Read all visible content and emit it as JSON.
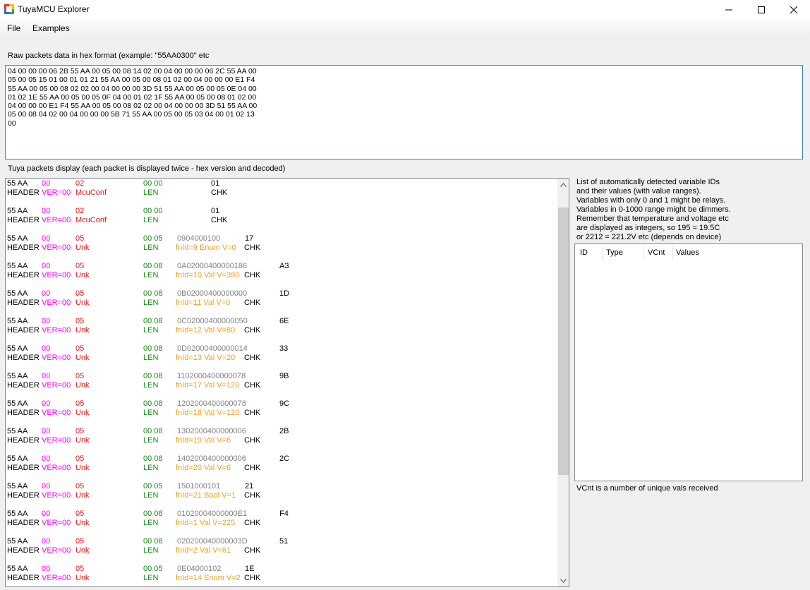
{
  "window": {
    "title": "TuyaMCU Explorer"
  },
  "menu": {
    "file": "File",
    "examples": "Examples"
  },
  "raw": {
    "label": "Raw packets data in hex format (example: \"55AA0300\" etc",
    "value": "04 00 00 00 06 2B 55 AA 00 05 00 08 14 02 00 04 00 00 00 06 2C 55 AA 00\n05 00 05 15 01 00 01 01 21 55 AA 00 05 00 08 01 02 00 04 00 00 00 E1 F4\n55 AA 00 05 00 08 02 02 00 04 00 00 00 3D 51 55 AA 00 05 00 05 0E 04 00\n01 02 1E 55 AA 00 05 00 05 0F 04 00 01 02 1F 55 AA 00 05 00 08 01 02 00\n04 00 00 00 E1 F4 55 AA 00 05 00 08 02 02 00 04 00 00 00 3D 51 55 AA 00\n05 00 08 04 02 00 04 00 00 00 5B 71 55 AA 00 05 00 05 03 04 00 01 02 13\n00\n"
  },
  "packets_label": "Tuya packets display (each packet is displayed twice - hex version and decoded)",
  "packets": [
    {
      "hdr": "55 AA",
      "ver": "00",
      "cmd": "02",
      "len": "00 00",
      "data": "",
      "chk": "01",
      "hdr2": "HEADER",
      "ver2": "VER=00",
      "cmd2": "McuConf",
      "len2": "LEN",
      "data2": "",
      "chk2": "CHK"
    },
    {
      "hdr": "55 AA",
      "ver": "00",
      "cmd": "02",
      "len": "00 00",
      "data": "",
      "chk": "01",
      "hdr2": "HEADER",
      "ver2": "VER=00",
      "cmd2": "McuConf",
      "len2": "LEN",
      "data2": "",
      "chk2": "CHK"
    },
    {
      "hdr": "55 AA",
      "ver": "00",
      "cmd": "05",
      "len": "00 05",
      "data": "0904000100",
      "chk": "17",
      "hdr2": "HEADER",
      "ver2": "VER=00",
      "cmd2": "Unk",
      "len2": "LEN",
      "data2": "fnId=9 Enum V=0",
      "chk2": "CHK"
    },
    {
      "hdr": "55 AA",
      "ver": "00",
      "cmd": "05",
      "len": "00 08",
      "data": "0A02000400000186",
      "chk": "A3",
      "hdr2": "HEADER",
      "ver2": "VER=00",
      "cmd2": "Unk",
      "len2": "LEN",
      "data2": "fnId=10 Val V=390",
      "chk2": "CHK"
    },
    {
      "hdr": "55 AA",
      "ver": "00",
      "cmd": "05",
      "len": "00 08",
      "data": "0B02000400000000",
      "chk": "1D",
      "hdr2": "HEADER",
      "ver2": "VER=00",
      "cmd2": "Unk",
      "len2": "LEN",
      "data2": "fnId=11 Val V=0",
      "chk2": "CHK"
    },
    {
      "hdr": "55 AA",
      "ver": "00",
      "cmd": "05",
      "len": "00 08",
      "data": "0C02000400000050",
      "chk": "6E",
      "hdr2": "HEADER",
      "ver2": "VER=00",
      "cmd2": "Unk",
      "len2": "LEN",
      "data2": "fnId=12 Val V=80",
      "chk2": "CHK"
    },
    {
      "hdr": "55 AA",
      "ver": "00",
      "cmd": "05",
      "len": "00 08",
      "data": "0D02000400000014",
      "chk": "33",
      "hdr2": "HEADER",
      "ver2": "VER=00",
      "cmd2": "Unk",
      "len2": "LEN",
      "data2": "fnId=13 Val V=20",
      "chk2": "CHK"
    },
    {
      "hdr": "55 AA",
      "ver": "00",
      "cmd": "05",
      "len": "00 08",
      "data": "1102000400000078",
      "chk": "9B",
      "hdr2": "HEADER",
      "ver2": "VER=00",
      "cmd2": "Unk",
      "len2": "LEN",
      "data2": "fnId=17 Val V=120",
      "chk2": "CHK"
    },
    {
      "hdr": "55 AA",
      "ver": "00",
      "cmd": "05",
      "len": "00 08",
      "data": "1202000400000078",
      "chk": "9C",
      "hdr2": "HEADER",
      "ver2": "VER=00",
      "cmd2": "Unk",
      "len2": "LEN",
      "data2": "fnId=18 Val V=120",
      "chk2": "CHK"
    },
    {
      "hdr": "55 AA",
      "ver": "00",
      "cmd": "05",
      "len": "00 08",
      "data": "1302000400000006",
      "chk": "2B",
      "hdr2": "HEADER",
      "ver2": "VER=00",
      "cmd2": "Unk",
      "len2": "LEN",
      "data2": "fnId=19 Val V=6",
      "chk2": "CHK"
    },
    {
      "hdr": "55 AA",
      "ver": "00",
      "cmd": "05",
      "len": "00 08",
      "data": "1402000400000006",
      "chk": "2C",
      "hdr2": "HEADER",
      "ver2": "VER=00",
      "cmd2": "Unk",
      "len2": "LEN",
      "data2": "fnId=20 Val V=6",
      "chk2": "CHK"
    },
    {
      "hdr": "55 AA",
      "ver": "00",
      "cmd": "05",
      "len": "00 05",
      "data": "1501000101",
      "chk": "21",
      "hdr2": "HEADER",
      "ver2": "VER=00",
      "cmd2": "Unk",
      "len2": "LEN",
      "data2": "fnId=21 Bool V=1",
      "chk2": "CHK"
    },
    {
      "hdr": "55 AA",
      "ver": "00",
      "cmd": "05",
      "len": "00 08",
      "data": "01020004000000E1",
      "chk": "F4",
      "hdr2": "HEADER",
      "ver2": "VER=00",
      "cmd2": "Unk",
      "len2": "LEN",
      "data2": "fnId=1 Val V=225",
      "chk2": "CHK"
    },
    {
      "hdr": "55 AA",
      "ver": "00",
      "cmd": "05",
      "len": "00 08",
      "data": "020200040000003D",
      "chk": "51",
      "hdr2": "HEADER",
      "ver2": "VER=00",
      "cmd2": "Unk",
      "len2": "LEN",
      "data2": "fnId=2 Val V=61",
      "chk2": "CHK"
    },
    {
      "hdr": "55 AA",
      "ver": "00",
      "cmd": "05",
      "len": "00 05",
      "data": "0E04000102",
      "chk": "1E",
      "hdr2": "HEADER",
      "ver2": "VER=00",
      "cmd2": "Unk",
      "len2": "LEN",
      "data2": "fnId=14 Enum V=2",
      "chk2": "CHK"
    }
  ],
  "info": "List of automatically detected variable IDs\nand their values (with value ranges).\nVariables with only 0 and 1 might be relays.\nVariables in 0-1000 range might be dimmers.\nRemember that temperature and voltage etc\nare displayed as integers, so 195 = 19.5C\nor 2212 = 221.2V etc (depends on device)",
  "varlist": {
    "id": "ID",
    "type": "Type",
    "vcnt": "VCnt",
    "values": "Values"
  },
  "vcnt_note": "VCnt is a number of unique vals received"
}
